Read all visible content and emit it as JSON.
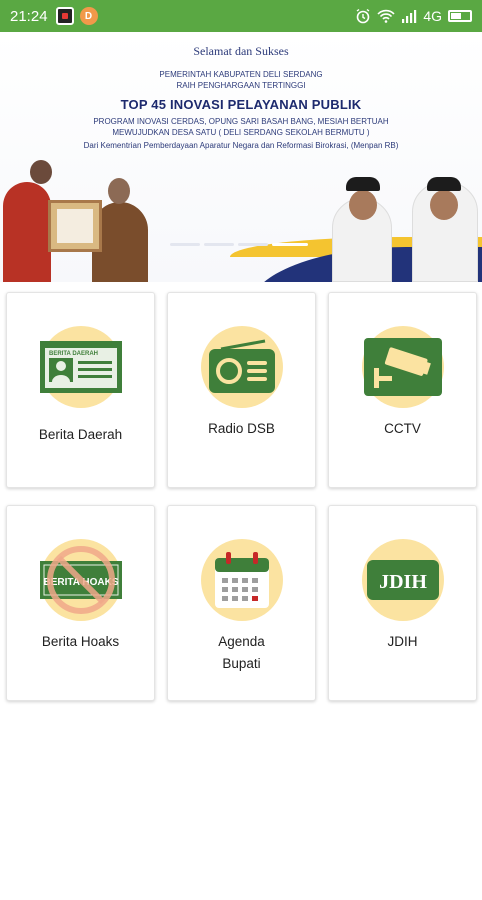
{
  "status_bar": {
    "time": "21:24",
    "network": "4G",
    "notif_app_badge": "D"
  },
  "banner": {
    "greeting": "Selamat dan Sukses",
    "line1": "PEMERINTAH KABUPATEN DELI SERDANG",
    "line2": "RAIH PENGHARGAAN TERTINGGI",
    "title": "TOP 45 INOVASI PELAYANAN PUBLIK",
    "program1": "PROGRAM INOVASI CERDAS, OPUNG SARI BASAH BANG, MESIAH BERTUAH",
    "program2": "MEWUJUDKAN DESA SATU ( DELI SERDANG SEKOLAH BERMUTU )",
    "source": "Dari Kementrian Pemberdayaan Aparatur Negara dan Reformasi Birokrasi, (Menpan RB)"
  },
  "menu": [
    {
      "label": "Berita Daerah",
      "icon": "newspaper-id-icon",
      "icon_text": "BERITA DAERAH"
    },
    {
      "label": "Radio DSB",
      "icon": "radio-icon"
    },
    {
      "label": "CCTV",
      "icon": "cctv-camera-icon"
    },
    {
      "label": "Berita Hoaks",
      "icon": "no-hoax-icon",
      "icon_text": "BERITA HOAKS"
    },
    {
      "label": "Agenda\nBupati",
      "icon": "calendar-icon"
    },
    {
      "label": "JDIH",
      "icon": "jdih-icon",
      "icon_text": "JDIH"
    }
  ],
  "colors": {
    "status_bar": "#5aa843",
    "icon_green": "#3f7f3a",
    "icon_circle": "#fbe3a1",
    "banner_navy": "#22337a",
    "banner_gold": "#f4c430"
  }
}
